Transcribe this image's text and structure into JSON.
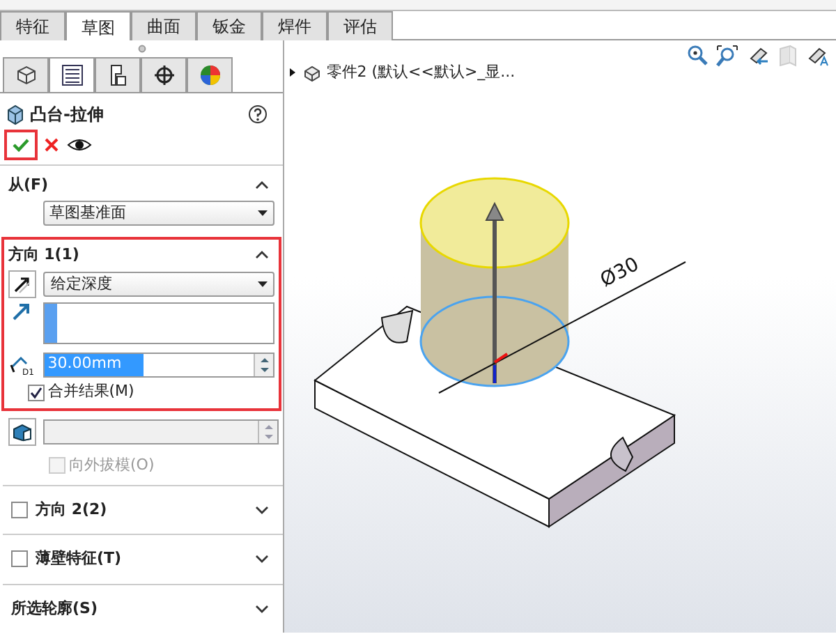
{
  "command_tabs": [
    {
      "label": "特征",
      "selected": false
    },
    {
      "label": "草图",
      "selected": true
    },
    {
      "label": "曲面",
      "selected": false
    },
    {
      "label": "钣金",
      "selected": false
    },
    {
      "label": "焊件",
      "selected": false
    },
    {
      "label": "评估",
      "selected": false
    }
  ],
  "manager_tabs": [
    {
      "kind": "tree",
      "selected": false
    },
    {
      "kind": "property",
      "selected": true
    },
    {
      "kind": "config",
      "selected": false
    },
    {
      "kind": "target",
      "selected": false
    },
    {
      "kind": "appearance",
      "selected": false
    }
  ],
  "feature": {
    "title": "凸台-拉伸",
    "ok_highlighted": true
  },
  "from": {
    "title": "从(F)",
    "value": "草图基准面",
    "expanded": true
  },
  "direction1": {
    "title": "方向 1(1)",
    "expanded": true,
    "highlighted": true,
    "end_condition": "给定深度",
    "depth_icon_text": "D1",
    "depth": "30.00mm",
    "merge": {
      "label": "合并结果(M)",
      "checked": true
    }
  },
  "draft": {
    "outward": {
      "label": "向外拔模(O)",
      "checked": false,
      "disabled": true
    }
  },
  "sections": [
    {
      "kind": "checkbox",
      "title": "方向 2(2)",
      "checked": false,
      "expanded": false
    },
    {
      "kind": "checkbox",
      "title": "薄壁特征(T)",
      "checked": false,
      "expanded": false
    },
    {
      "kind": "plain",
      "title": "所选轮廓(S)",
      "expanded": false
    }
  ],
  "tree": {
    "root": "零件2  (默认<<默认>_显...",
    "expanded": false
  },
  "model": {
    "dimension": "Ø30"
  }
}
